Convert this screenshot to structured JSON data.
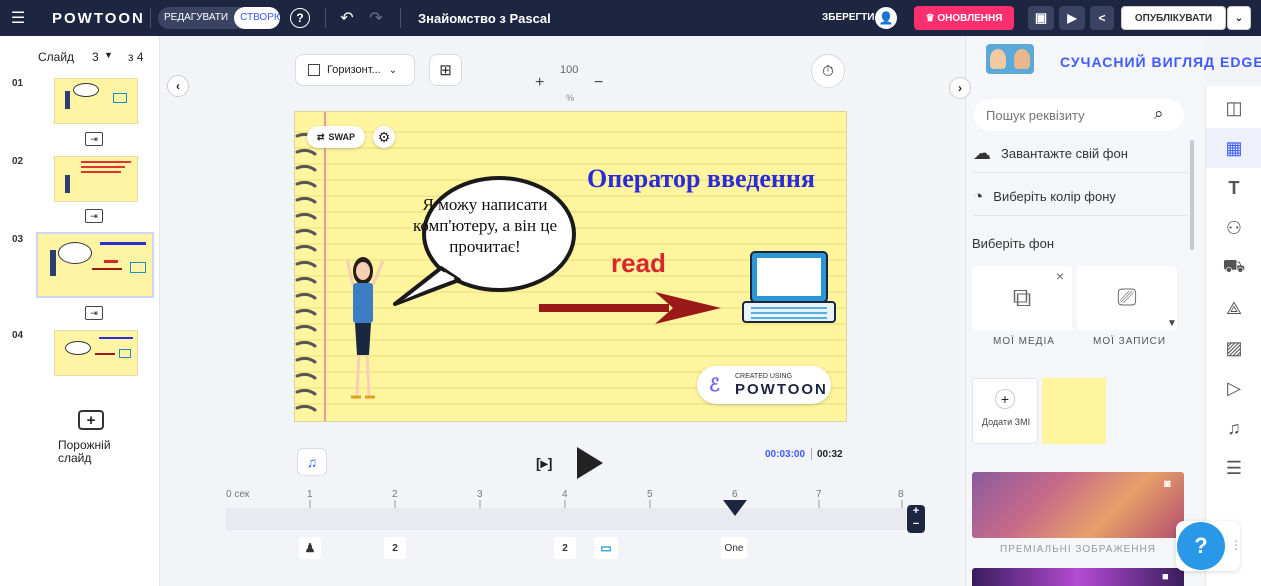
{
  "app": {
    "logo": "POWTOON",
    "mode_edit": "РЕДАГУВАТИ",
    "mode_create": "СТВОРЮЙТЕ",
    "title": "Знайомство з Pascal",
    "save_label": "ЗБЕРЕГТИ",
    "upgrade_label": "♛ ОНОВЛЕННЯ",
    "publish_label": "ОПУБЛІКУВАТИ"
  },
  "left_panel": {
    "slide_label": "Слайд",
    "current_slide": "3",
    "total_slides": "з 4",
    "slides": [
      {
        "num": "01"
      },
      {
        "num": "02"
      },
      {
        "num": "03"
      },
      {
        "num": "04"
      }
    ],
    "blank_slide": "Порожній слайд"
  },
  "canvas": {
    "orientation": "Горизонт...",
    "zoom_value": "100",
    "zoom_unit": "%",
    "zoom_plus": "+",
    "zoom_minus": "−",
    "swap_label": "SWAP",
    "slide_title": "Оператор введення",
    "bubble_text": "Я можу написати комп'ютеру, а він це прочитає!",
    "read_text": "read",
    "watermark_small": "CREATED USING",
    "watermark_big": "POWTOON"
  },
  "player": {
    "time_current": "00:03:00",
    "time_total": "00:32",
    "play_icon_label": "[▸]"
  },
  "timeline": {
    "ticks": [
      "0 сек",
      "1",
      "2",
      "3",
      "4",
      "5",
      "6",
      "7",
      "8"
    ],
    "markers": [
      "2",
      "2",
      "One"
    ],
    "zoom_plus": "+",
    "zoom_minus": "−"
  },
  "right_panel": {
    "header": "СУЧАСНИЙ ВИГЛЯД EDGE",
    "search_placeholder": "Пошук реквізиту",
    "upload_bg": "Завантажте свій фон",
    "choose_color": "Виберіть колір фону",
    "choose_bg": "Виберіть фон",
    "my_media": "МОЇ МЕДІА",
    "my_records": "МОЇ ЗАПИСИ",
    "add_media": "Додати ЗМІ",
    "premium_images": "ПРЕМІАЛЬНІ ЗОБРАЖЕННЯ",
    "help": "?"
  },
  "colors": {
    "topbar": "#1d2541",
    "accent": "#3d5afe",
    "upgrade": "#ff2f6e",
    "slide_bg": "#fff59f",
    "title_blue": "#2b2bd8",
    "read_red": "#d8262b"
  }
}
